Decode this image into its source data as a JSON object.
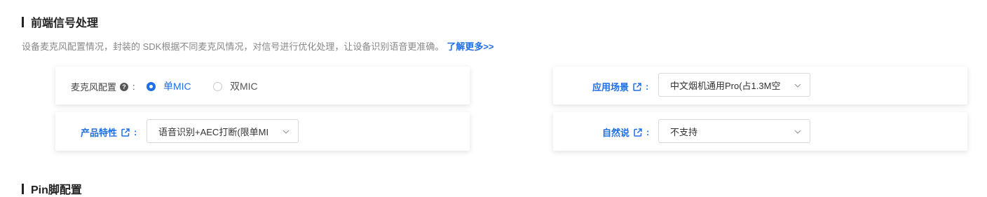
{
  "section1": {
    "title": "前端信号处理",
    "description": "设备麦克风配置情况，封装的 SDK根据不同麦克风情况，对信号进行优化处理，让设备识别语音更准确。",
    "learn_more": "了解更多>>"
  },
  "mic_config": {
    "label": "麦克风配置",
    "help_icon": "?",
    "colon": ":",
    "options": [
      "单MIC",
      "双MIC"
    ],
    "selected": "单MIC"
  },
  "scene": {
    "label": "应用场景",
    "colon": ":",
    "value": "中文烟机通用Pro(占1.3M空"
  },
  "product_feature": {
    "label": "产品特性",
    "colon": ":",
    "value": "语音识别+AEC打断(限单MI"
  },
  "free_speech": {
    "label": "自然说",
    "colon": ":",
    "value": "不支持"
  },
  "section2": {
    "title": "Pin脚配置"
  },
  "colors": {
    "accent": "#1f6fe5"
  }
}
